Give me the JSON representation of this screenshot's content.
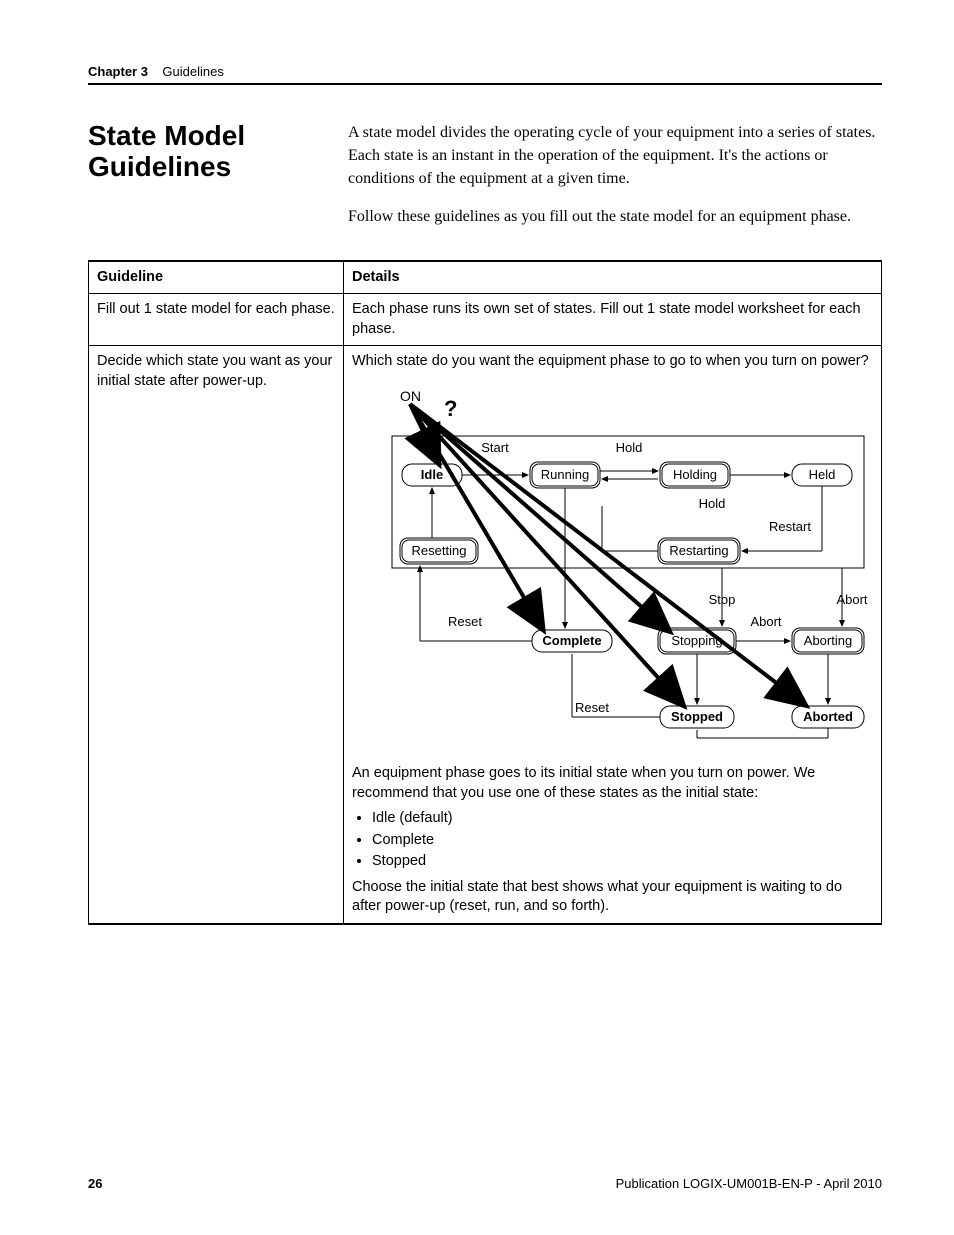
{
  "running_header": {
    "chapter": "Chapter 3",
    "title": "Guidelines"
  },
  "section": {
    "title": "State Model Guidelines",
    "para1": "A state model divides the operating cycle of your equipment into a series of states. Each state is an instant in the operation of the equipment. It's the actions or conditions of the equipment at a given time.",
    "para2": "Follow these guidelines as you fill out the state model for an equipment phase."
  },
  "table": {
    "headers": {
      "guideline": "Guideline",
      "details": "Details"
    },
    "rows": [
      {
        "guideline": "Fill out 1 state model for each phase.",
        "details": "Each phase runs its own set of states. Fill out 1 state model worksheet for each phase."
      },
      {
        "guideline": "Decide which state you want as your initial state after power-up.",
        "intro": "Which state do you want the equipment phase to go to when you turn on power?",
        "after_diagram": "An equipment phase goes to its initial state when you turn on power. We recommend that you use one of these states as the initial state:",
        "bullets": [
          "Idle (default)",
          "Complete",
          "Stopped"
        ],
        "closing": "Choose the initial state that best shows what your equipment is waiting to do after power-up (reset, run, and so forth)."
      }
    ]
  },
  "diagram": {
    "on_label": "ON",
    "question_mark": "?",
    "states": {
      "idle": "Idle",
      "running": "Running",
      "holding": "Holding",
      "held": "Held",
      "resetting": "Resetting",
      "restarting": "Restarting",
      "complete": "Complete",
      "stopping": "Stopping",
      "aborting": "Aborting",
      "stopped": "Stopped",
      "aborted": "Aborted"
    },
    "transitions": {
      "start": "Start",
      "hold_top": "Hold",
      "hold_mid": "Hold",
      "restart": "Restart",
      "stop": "Stop",
      "abort_right": "Abort",
      "abort_mid": "Abort",
      "reset_left": "Reset",
      "reset_bottom": "Reset"
    }
  },
  "footer": {
    "page_number": "26",
    "publication": "Publication LOGIX-UM001B-EN-P - April 2010"
  }
}
